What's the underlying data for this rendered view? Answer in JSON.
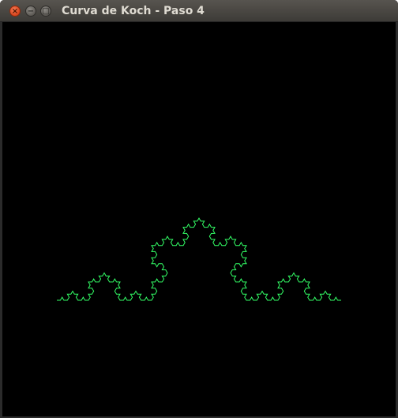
{
  "window": {
    "title": "Curva de Koch - Paso 4",
    "close_glyph": "×",
    "minimize_glyph": "−",
    "maximize_glyph": "□"
  },
  "canvas": {
    "background_color": "#000000",
    "stroke_color": "#33ff66",
    "koch": {
      "iterations": 4
    }
  }
}
